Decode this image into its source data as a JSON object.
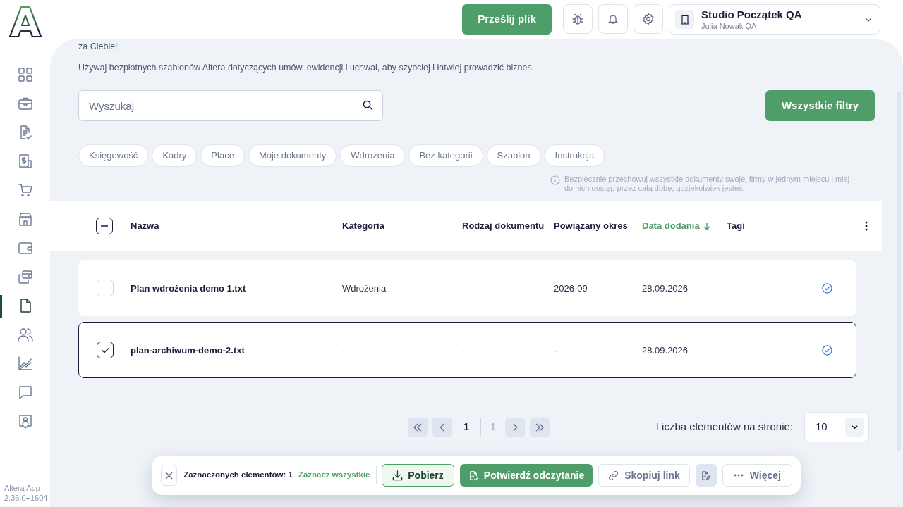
{
  "sidebar": {
    "items": [
      {
        "selected": false
      },
      {
        "selected": false
      },
      {
        "selected": false
      },
      {
        "selected": false
      },
      {
        "selected": false
      },
      {
        "selected": false
      },
      {
        "selected": false
      },
      {
        "selected": false
      },
      {
        "selected": true
      },
      {
        "selected": false
      },
      {
        "selected": false
      },
      {
        "selected": false
      },
      {
        "selected": false
      }
    ],
    "app_name": "Altera App",
    "version": "2.36.0+1604"
  },
  "header": {
    "upload_button": "Prześlij plik",
    "organization": {
      "name": "Studio Początek QA",
      "user": "Julia Nowak QA"
    }
  },
  "intro": [
    "za Ciebie!",
    "Używaj bezpłatnych szablonów Altera dotyczących umów, ewidencji i uchwał, aby szybciej i łatwiej prowadzić biznes."
  ],
  "search": {
    "placeholder": "Wyszukaj"
  },
  "filters_button": "Wszystkie filtry",
  "categories": [
    {
      "label": "Księgowość",
      "selected": false
    },
    {
      "label": "Kadry",
      "selected": false
    },
    {
      "label": "Płace",
      "selected": false
    },
    {
      "label": "Moje dokumenty",
      "selected": false
    },
    {
      "label": "Wdrożenia",
      "selected": false
    },
    {
      "label": "Bez kategorii",
      "selected": false
    },
    {
      "label": "Szablon",
      "selected": false
    },
    {
      "label": "Instrukcja",
      "selected": false
    }
  ],
  "info": "Bezpiecznie przechowuj wszystkie dokumenty swojej firmy w jednym miejscu i miej do nich dostęp przez całą dobę, gdziekolwiek jesteś.",
  "table": {
    "select_all": {
      "indeterminate": true
    },
    "columns": [
      {
        "label": "Nazwa",
        "sorted": false
      },
      {
        "label": "Kategoria",
        "sorted": false
      },
      {
        "label": "Rodzaj dokumentu",
        "sorted": false
      },
      {
        "label": "Powiązany okres",
        "sorted": false
      },
      {
        "label": "Data dodania",
        "sorted": true,
        "descending": true
      },
      {
        "label": "Tagi",
        "sorted": false
      }
    ],
    "rows": [
      {
        "name": "Plan wdrożenia demo 1.txt",
        "category": "Wdrożenia",
        "document_type": "-",
        "period": "2026-09",
        "date_added": "28.09.2026",
        "selected": false,
        "confirmed": true
      },
      {
        "name": "plan-archiwum-demo-2.txt",
        "category": "-",
        "document_type": "-",
        "period": "-",
        "date_added": "28.09.2026",
        "selected": true,
        "confirmed": true
      }
    ]
  },
  "pagination": {
    "current": "1",
    "total": "1",
    "page_size_label": "Liczba elementów na stronie:",
    "page_size": "10"
  },
  "selection_bar": {
    "count_text": "Zaznaczonych elementów: 1",
    "select_all_link": "Zaznacz wszystkie",
    "actions": [
      {
        "kind": "download",
        "label": "Pobierz"
      },
      {
        "kind": "confirm",
        "label": "Potwierdź odczytanie"
      },
      {
        "kind": "link",
        "label": "Skopiuj link"
      },
      {
        "kind": "icon"
      },
      {
        "kind": "more",
        "label": "Więcej"
      }
    ]
  }
}
